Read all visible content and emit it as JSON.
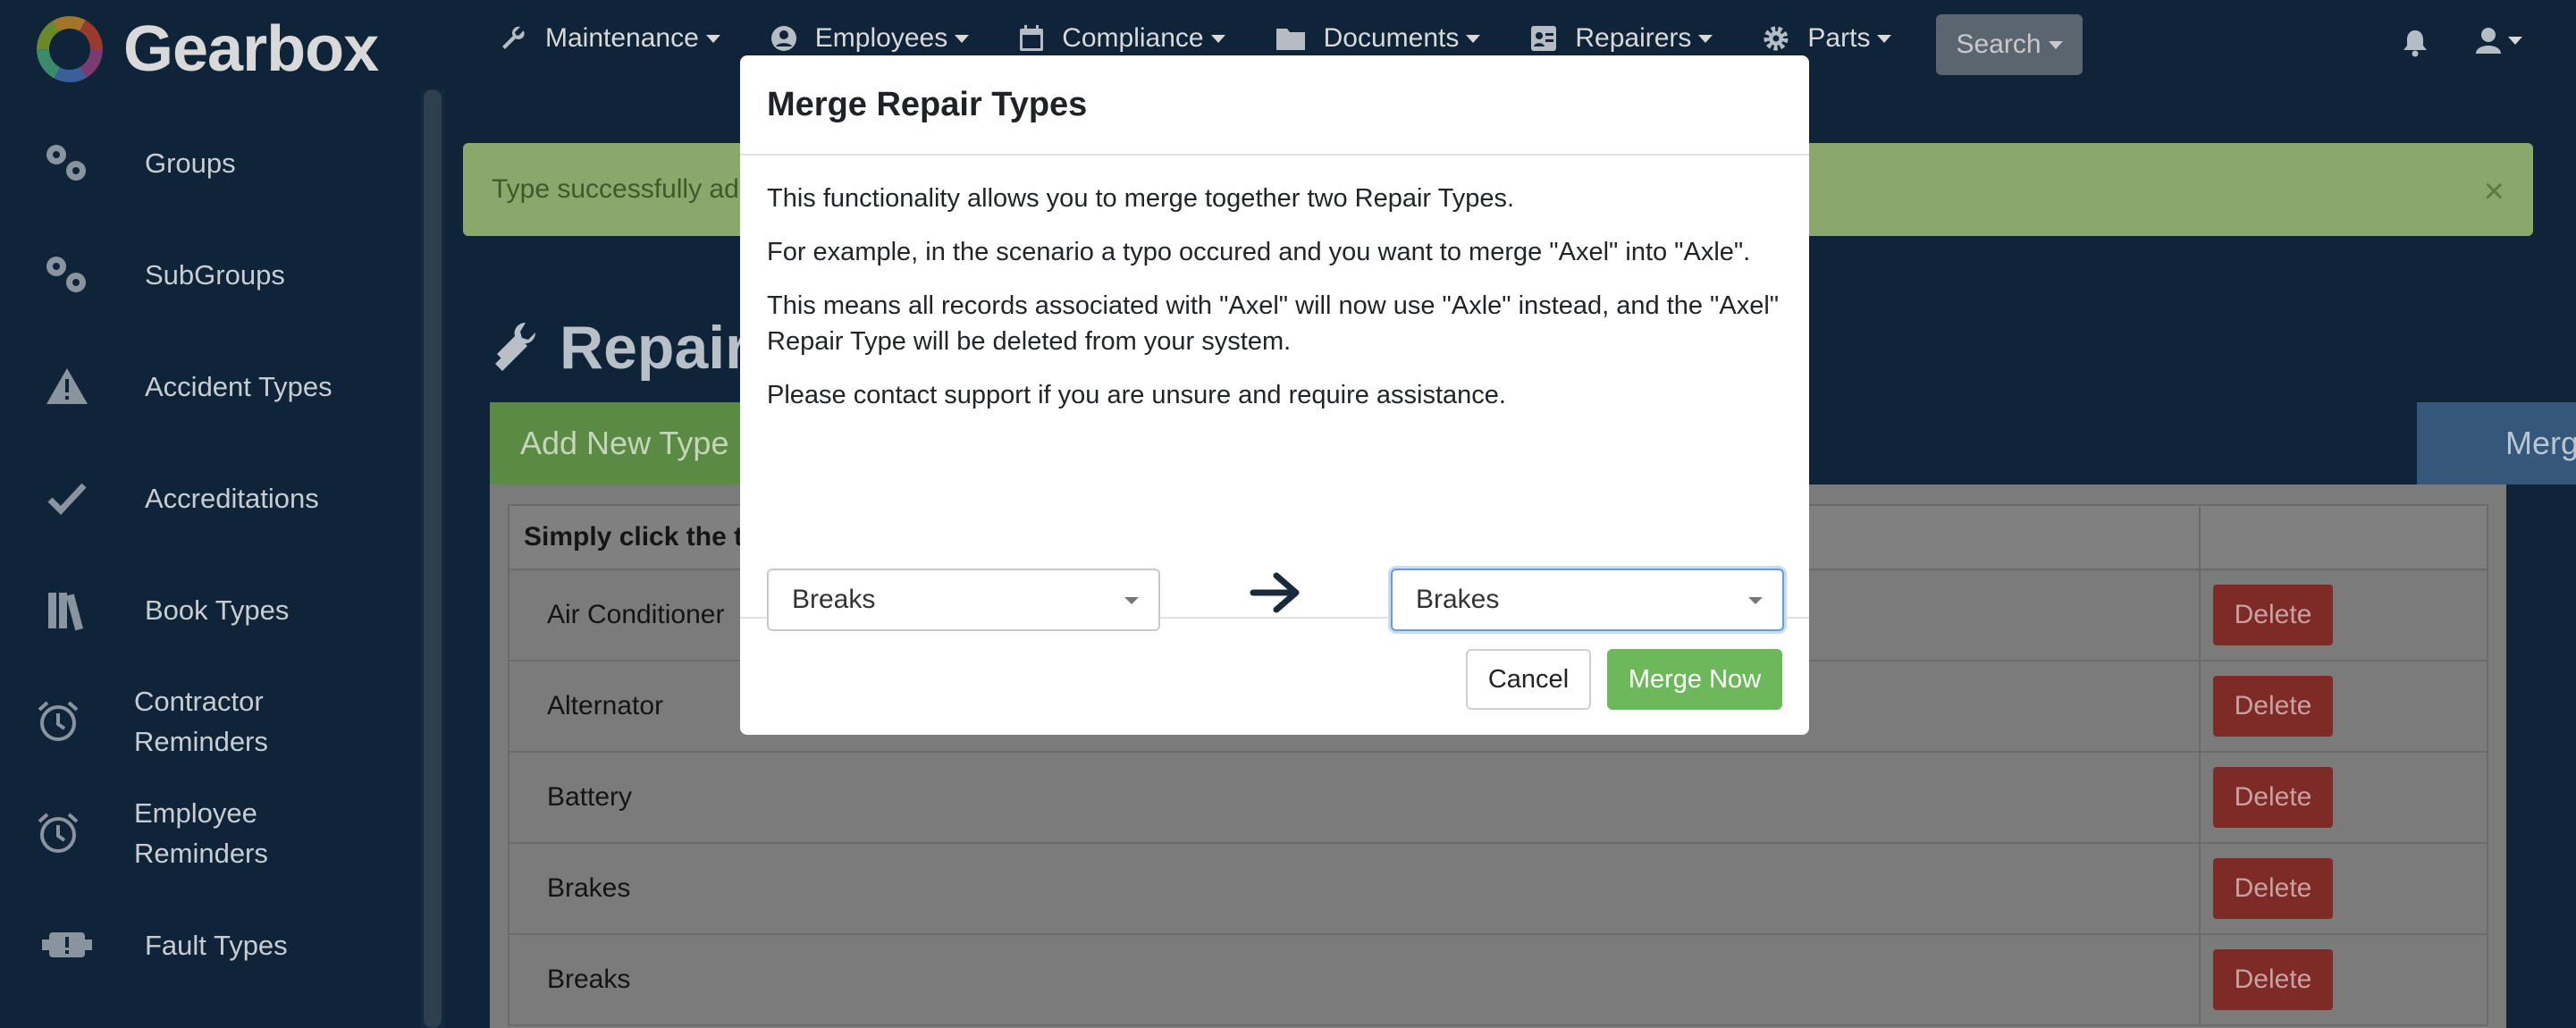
{
  "brand": {
    "name": "Gearbox"
  },
  "nav": {
    "items": [
      {
        "label": "Maintenance",
        "icon": "wrench-icon"
      },
      {
        "label": "Employees",
        "icon": "user-circle-icon"
      },
      {
        "label": "Compliance",
        "icon": "calendar-icon"
      },
      {
        "label": "Documents",
        "icon": "folder-icon"
      },
      {
        "label": "Repairers",
        "icon": "address-card-icon"
      },
      {
        "label": "Parts",
        "icon": "gear-icon"
      }
    ],
    "search_label": "Search"
  },
  "sidebar": {
    "items": [
      {
        "label": "Groups",
        "icon": "gears-icon"
      },
      {
        "label": "SubGroups",
        "icon": "gears-icon"
      },
      {
        "label": "Accident Types",
        "icon": "warning-icon"
      },
      {
        "label": "Accreditations",
        "icon": "check-icon"
      },
      {
        "label": "Book Types",
        "icon": "books-icon"
      },
      {
        "label_line1": "Contractor",
        "label_line2": "Reminders",
        "icon": "alarm-clock-icon"
      },
      {
        "label_line1": "Employee",
        "label_line2": "Reminders",
        "icon": "alarm-clock-icon"
      },
      {
        "label": "Fault Types",
        "icon": "engine-warning-icon"
      }
    ]
  },
  "alert": {
    "text": "Type successfully adde",
    "close": "×"
  },
  "page": {
    "title": "Repair T",
    "add_button": "Add New Type",
    "merge_tab": "Merge",
    "table_header": "Simply click the ty",
    "rows": [
      {
        "name": "Air Conditioner",
        "delete": "Delete"
      },
      {
        "name": "Alternator",
        "delete": "Delete"
      },
      {
        "name": "Battery",
        "delete": "Delete"
      },
      {
        "name": "Brakes",
        "delete": "Delete"
      },
      {
        "name": "Breaks",
        "delete": "Delete"
      }
    ]
  },
  "modal": {
    "title": "Merge Repair Types",
    "paragraphs": [
      "This functionality allows you to merge together two Repair Types.",
      "For example, in the scenario a typo occured and you want to merge \"Axel\" into \"Axle\".",
      "This means all records associated with \"Axel\" will now use \"Axle\" instead, and the \"Axel\" Repair Type will be deleted from your system.",
      "Please contact support if you are unsure and require assistance."
    ],
    "from_value": "Breaks",
    "to_value": "Brakes",
    "cancel_label": "Cancel",
    "merge_label": "Merge Now"
  },
  "colors": {
    "background": "#0f2438",
    "merge_button": "#6db85a",
    "delete_button": "#d9534f",
    "alert": "#dff0d8",
    "add_button": "#5cb85c",
    "merge_tab": "#4a7dbf"
  }
}
